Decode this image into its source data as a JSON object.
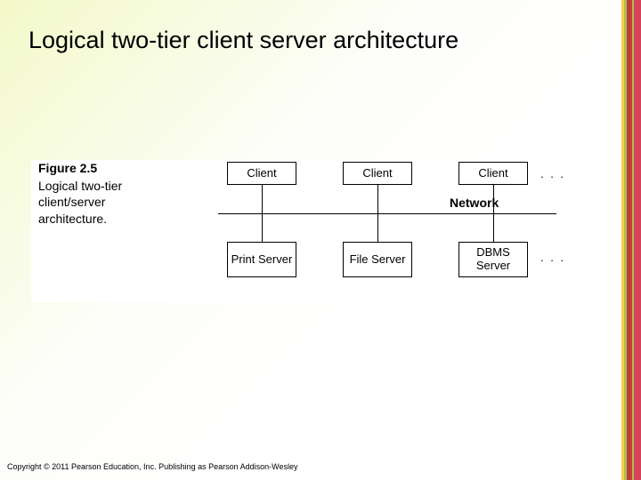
{
  "title": "Logical two-tier client server architecture",
  "figure": {
    "number": "Figure 2.5",
    "caption": "Logical two-tier client/server architecture."
  },
  "diagram": {
    "clients": [
      "Client",
      "Client",
      "Client"
    ],
    "clients_ellipsis": ". . .",
    "network_label": "Network",
    "servers": [
      "Print\nServer",
      "File\nServer",
      "DBMS\nServer"
    ],
    "servers_ellipsis": ". . ."
  },
  "copyright": "Copyright © 2011 Pearson Education, Inc. Publishing as Pearson Addison-Wesley"
}
